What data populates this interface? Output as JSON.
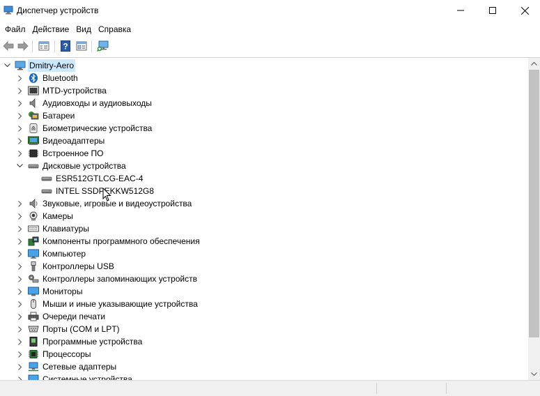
{
  "window": {
    "title": "Диспетчер устройств",
    "controls": {
      "minimize": "—",
      "maximize": "☐",
      "close": "✕"
    }
  },
  "menu": {
    "items": [
      {
        "label": "Файл"
      },
      {
        "label": "Действие"
      },
      {
        "label": "Вид"
      },
      {
        "label": "Справка"
      }
    ]
  },
  "toolbar": {
    "buttons": [
      "back-icon",
      "forward-icon",
      "properties-icon",
      "help-icon",
      "view-icon",
      "scan-hardware-icon"
    ]
  },
  "tree": {
    "root": {
      "label": "Dmitry-Aero",
      "icon": "computer-root-icon",
      "expanded": true,
      "selected": true
    },
    "items": [
      {
        "label": "Bluetooth",
        "icon": "bluetooth-icon",
        "expanded": false,
        "level": 1
      },
      {
        "label": "MTD-устройства",
        "icon": "mtd-icon",
        "expanded": false,
        "level": 1
      },
      {
        "label": "Аудиовходы и аудиовыходы",
        "icon": "speaker-icon",
        "expanded": false,
        "level": 1
      },
      {
        "label": "Батареи",
        "icon": "battery-icon",
        "expanded": false,
        "level": 1
      },
      {
        "label": "Биометрические устройства",
        "icon": "fingerprint-icon",
        "expanded": false,
        "level": 1
      },
      {
        "label": "Видеоадаптеры",
        "icon": "display-adapter-icon",
        "expanded": false,
        "level": 1
      },
      {
        "label": "Встроенное ПО",
        "icon": "firmware-icon",
        "expanded": false,
        "level": 1
      },
      {
        "label": "Дисковые устройства",
        "icon": "disk-drive-icon",
        "expanded": true,
        "level": 1
      },
      {
        "label": "ESR512GTLCG-EAC-4",
        "icon": "disk-drive-icon",
        "level": 2
      },
      {
        "label": "INTEL SSDPEKKW512G8",
        "icon": "disk-drive-icon",
        "level": 2
      },
      {
        "label": "Звуковые, игровые и видеоустройства",
        "icon": "speaker-icon",
        "expanded": false,
        "level": 1
      },
      {
        "label": "Камеры",
        "icon": "camera-icon",
        "expanded": false,
        "level": 1
      },
      {
        "label": "Клавиатуры",
        "icon": "keyboard-icon",
        "expanded": false,
        "level": 1
      },
      {
        "label": "Компоненты программного обеспечения",
        "icon": "software-component-icon",
        "expanded": false,
        "level": 1
      },
      {
        "label": "Компьютер",
        "icon": "computer-icon",
        "expanded": false,
        "level": 1
      },
      {
        "label": "Контроллеры USB",
        "icon": "usb-icon",
        "expanded": false,
        "level": 1
      },
      {
        "label": "Контроллеры запоминающих устройств",
        "icon": "storage-controller-icon",
        "expanded": false,
        "level": 1
      },
      {
        "label": "Мониторы",
        "icon": "monitor-icon",
        "expanded": false,
        "level": 1
      },
      {
        "label": "Мыши и иные указывающие устройства",
        "icon": "mouse-icon",
        "expanded": false,
        "level": 1
      },
      {
        "label": "Очереди печати",
        "icon": "printer-icon",
        "expanded": false,
        "level": 1
      },
      {
        "label": "Порты (COM и LPT)",
        "icon": "port-icon",
        "expanded": false,
        "level": 1
      },
      {
        "label": "Программные устройства",
        "icon": "software-device-icon",
        "expanded": false,
        "level": 1
      },
      {
        "label": "Процессоры",
        "icon": "processor-icon",
        "expanded": false,
        "level": 1
      },
      {
        "label": "Сетевые адаптеры",
        "icon": "network-adapter-icon",
        "expanded": false,
        "level": 1
      },
      {
        "label": "Системные устройства",
        "icon": "system-device-icon",
        "expanded": false,
        "level": 1
      }
    ]
  },
  "colors": {
    "selection": "#cce8ff",
    "scroll_thumb": "#c2c2c2",
    "scroll_track": "#f0f0f0"
  }
}
